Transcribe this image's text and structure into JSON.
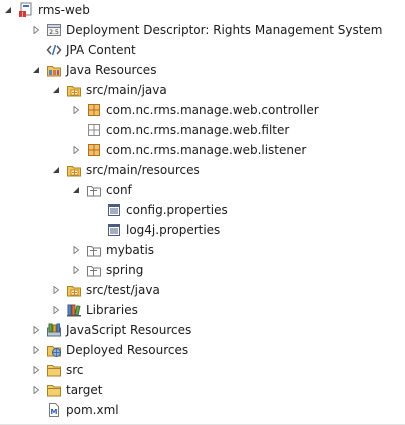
{
  "tree": {
    "project": {
      "label": "rms-web"
    },
    "deployment_descriptor": {
      "label": "Deployment Descriptor: Rights Management System"
    },
    "jpa_content": {
      "label": "JPA Content"
    },
    "java_resources": {
      "label": "Java Resources"
    },
    "src_main_java": {
      "label": "src/main/java"
    },
    "pkg_controller": {
      "label": "com.nc.rms.manage.web.controller"
    },
    "pkg_filter": {
      "label": "com.nc.rms.manage.web.filter"
    },
    "pkg_listener": {
      "label": "com.nc.rms.manage.web.listener"
    },
    "src_main_resources": {
      "label": "src/main/resources"
    },
    "conf": {
      "label": "conf"
    },
    "config_properties": {
      "label": "config.properties"
    },
    "log4j_properties": {
      "label": "log4j.properties"
    },
    "mybatis": {
      "label": "mybatis"
    },
    "spring": {
      "label": "spring"
    },
    "src_test_java": {
      "label": "src/test/java"
    },
    "libraries": {
      "label": "Libraries"
    },
    "javascript_resources": {
      "label": "JavaScript Resources"
    },
    "deployed_resources": {
      "label": "Deployed Resources"
    },
    "src": {
      "label": "src"
    },
    "target": {
      "label": "target"
    },
    "pom_xml": {
      "label": "pom.xml"
    }
  },
  "colors": {
    "folder": "#e8b84a",
    "package": "#c8841e",
    "jar": "#b06a2a"
  }
}
